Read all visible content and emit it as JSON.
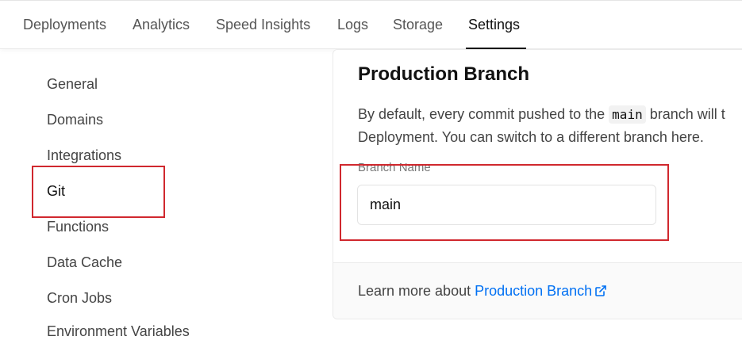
{
  "tabs": [
    {
      "label": "Deployments"
    },
    {
      "label": "Analytics"
    },
    {
      "label": "Speed Insights"
    },
    {
      "label": "Logs"
    },
    {
      "label": "Storage"
    },
    {
      "label": "Settings",
      "active": true
    }
  ],
  "sidebar": {
    "items": [
      {
        "label": "General"
      },
      {
        "label": "Domains"
      },
      {
        "label": "Integrations"
      },
      {
        "label": "Git",
        "active": true
      },
      {
        "label": "Functions"
      },
      {
        "label": "Data Cache"
      },
      {
        "label": "Cron Jobs"
      },
      {
        "label": "Environment Variables"
      }
    ]
  },
  "main": {
    "title": "Production Branch",
    "desc_part1": "By default, every commit pushed to the ",
    "desc_code": "main",
    "desc_part2": " branch will t",
    "desc_line2": "Deployment. You can switch to a different branch here.",
    "field_label": "Branch Name",
    "field_value": "main",
    "footer_prefix": "Learn more about ",
    "footer_link": "Production Branch",
    "footer_icon": "external-link-icon"
  },
  "colors": {
    "link": "#0070f3",
    "highlight": "#d0282e",
    "active_tab": "#111111"
  }
}
